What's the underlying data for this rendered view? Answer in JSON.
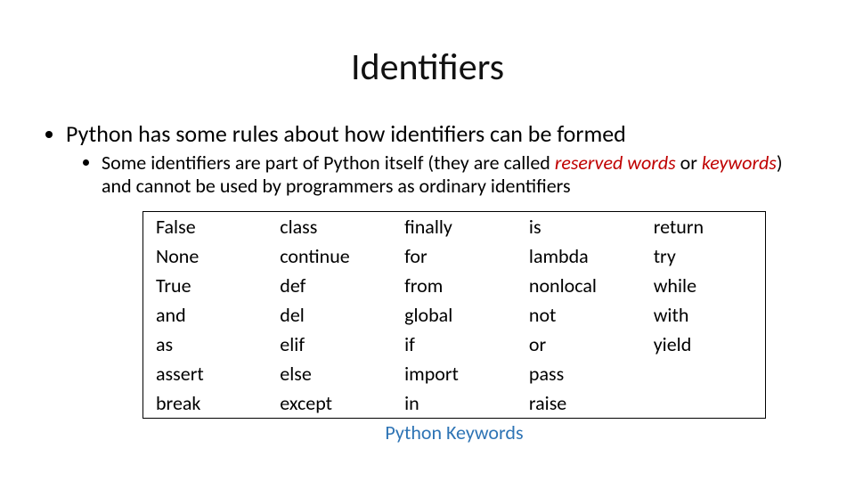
{
  "title": "Identifiers",
  "bullets": {
    "l1": "Python has some rules about how identifiers can be formed",
    "l2_pre": "Some identifiers are part of Python itself (they are called ",
    "l2_em1": "reserved words",
    "l2_mid": " or ",
    "l2_em2": "keywords",
    "l2_post": ") and cannot be used by programmers as ordinary identifiers"
  },
  "table": {
    "caption": "Python Keywords",
    "rows": [
      [
        "False",
        "class",
        "finally",
        "is",
        "return"
      ],
      [
        "None",
        "continue",
        "for",
        "lambda",
        "try"
      ],
      [
        "True",
        "def",
        "from",
        "nonlocal",
        "while"
      ],
      [
        "and",
        "del",
        "global",
        "not",
        "with"
      ],
      [
        "as",
        "elif",
        "if",
        "or",
        "yield"
      ],
      [
        "assert",
        "else",
        "import",
        "pass",
        ""
      ],
      [
        "break",
        "except",
        "in",
        "raise",
        ""
      ]
    ]
  }
}
